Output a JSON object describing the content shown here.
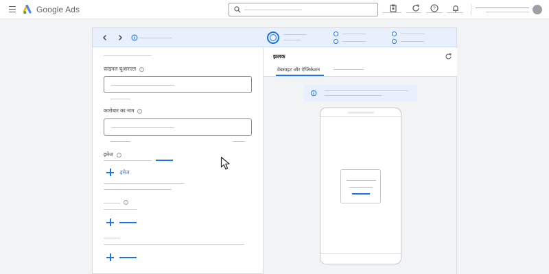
{
  "app": {
    "brand_name": "Google Ads",
    "brand_colors": {
      "blue": "#4285F4",
      "yellow": "#FBBC04",
      "green": "#34A853"
    },
    "accent_color": "#1a73e8"
  },
  "topbar": {
    "icons": [
      "menu-icon",
      "search-icon",
      "tools-icon",
      "refresh-icon",
      "help-icon",
      "notifications-icon",
      "account-avatar"
    ]
  },
  "wizard": {
    "nav_icons": [
      "chevron-left-icon",
      "chevron-right-icon",
      "info-icon"
    ],
    "steps_visible": 5
  },
  "form": {
    "final_url_label": "फ़ाइनल यूआरएल",
    "business_name_label": "कारोबार का नाम",
    "images_label": "इमेज",
    "add_image_label": "इमेज"
  },
  "preview": {
    "title": "झलक",
    "tabs": [
      {
        "label": "वेबसाइट और ऐप्लिकेशन",
        "selected": true
      },
      {
        "label": "",
        "selected": false
      }
    ]
  }
}
